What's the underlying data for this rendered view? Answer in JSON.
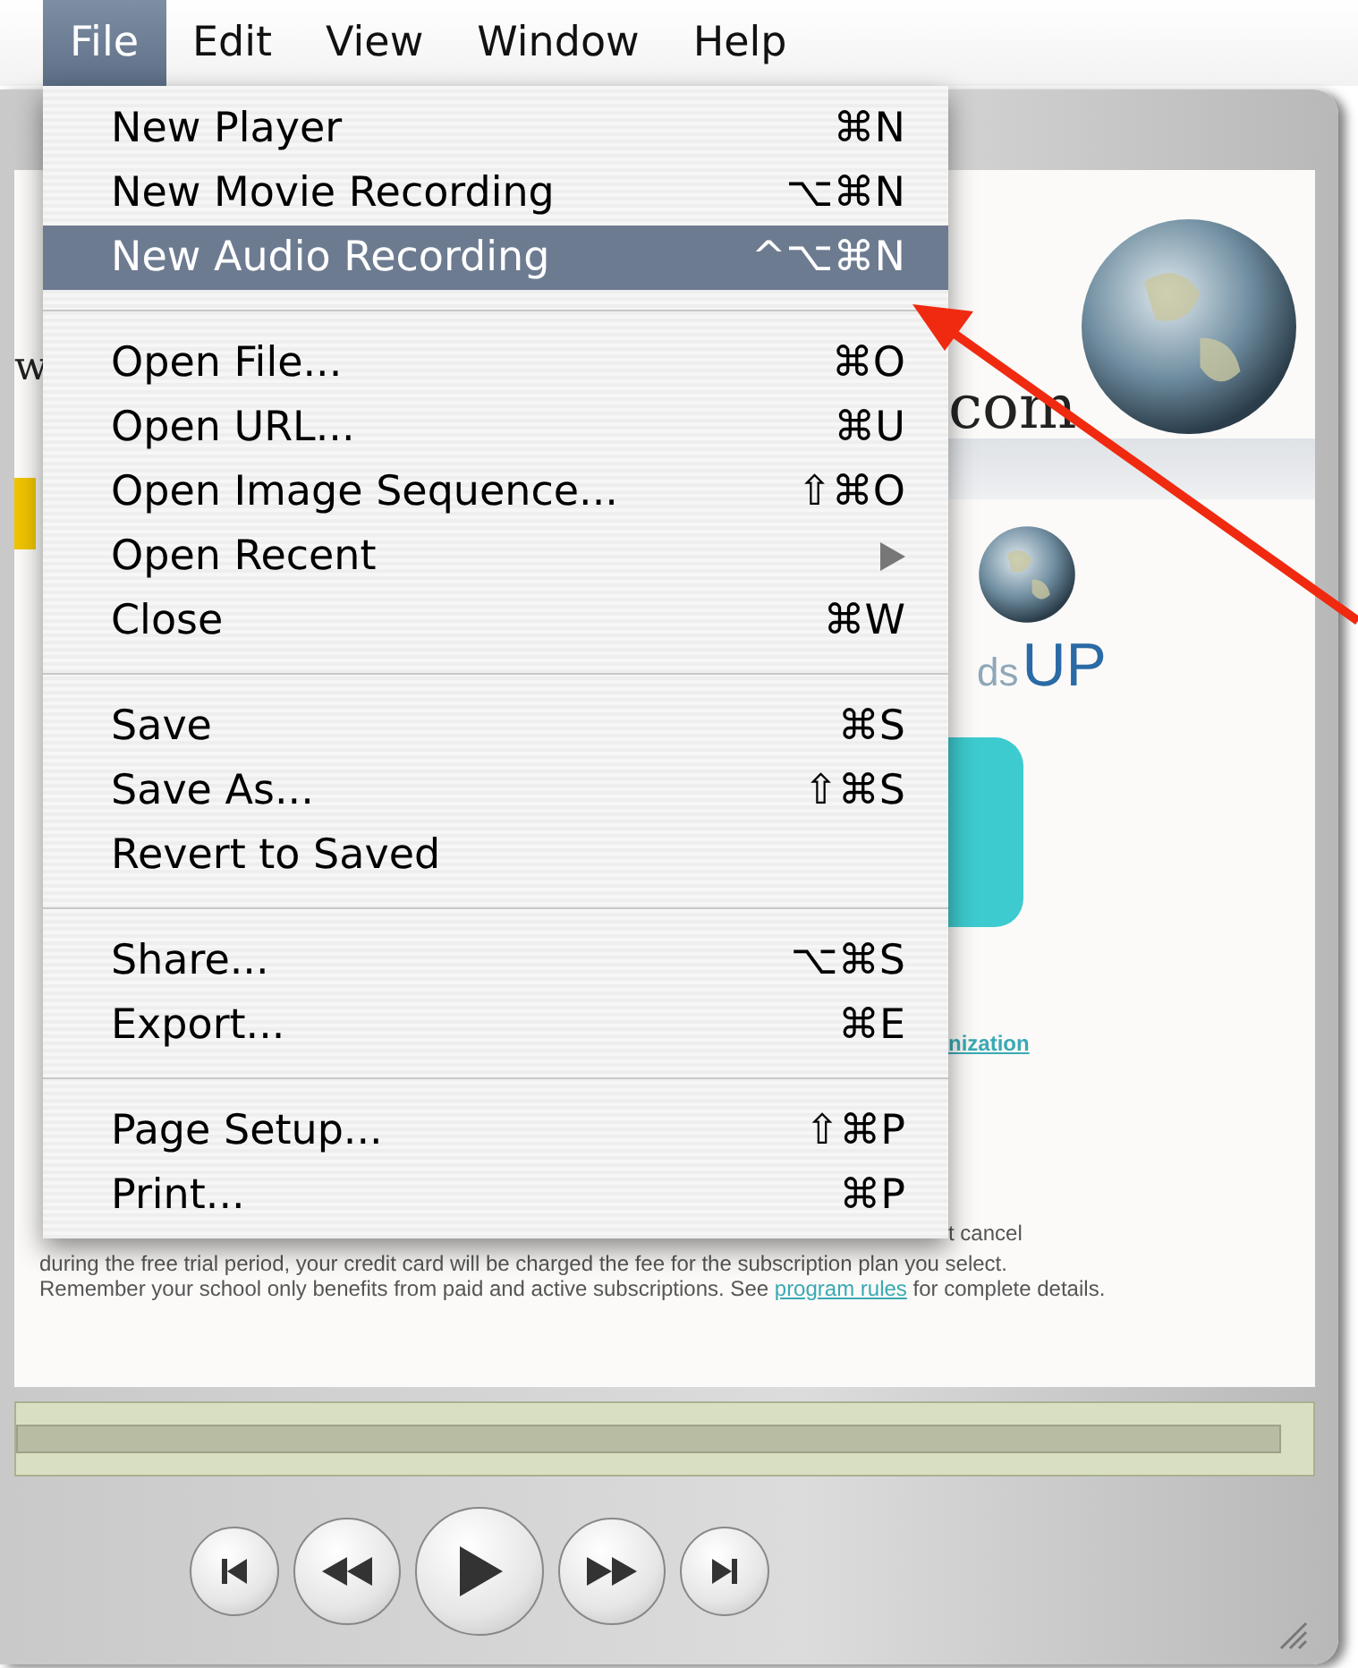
{
  "menu_bar": [
    {
      "label": "File",
      "selected": true
    },
    {
      "label": "Edit",
      "selected": false
    },
    {
      "label": "View",
      "selected": false
    },
    {
      "label": "Window",
      "selected": false
    },
    {
      "label": "Help",
      "selected": false
    }
  ],
  "menu": {
    "groups": [
      [
        {
          "kind": "item",
          "label": "New Player",
          "shortcut": "⌘N",
          "highlighted": false
        },
        {
          "kind": "item",
          "label": "New Movie Recording",
          "shortcut": "⌥⌘N",
          "highlighted": false
        },
        {
          "kind": "item",
          "label": "New Audio Recording",
          "shortcut": "^⌥⌘N",
          "highlighted": true
        }
      ],
      [
        {
          "kind": "item",
          "label": "Open File...",
          "shortcut": "⌘O",
          "highlighted": false
        },
        {
          "kind": "item",
          "label": "Open URL...",
          "shortcut": "⌘U",
          "highlighted": false
        },
        {
          "kind": "item",
          "label": "Open Image Sequence...",
          "shortcut": "⇧⌘O",
          "highlighted": false
        },
        {
          "kind": "submenu",
          "label": "Open Recent",
          "highlighted": false
        },
        {
          "kind": "item",
          "label": "Close",
          "shortcut": "⌘W",
          "highlighted": false
        }
      ],
      [
        {
          "kind": "item",
          "label": "Save",
          "shortcut": "⌘S",
          "highlighted": false
        },
        {
          "kind": "item",
          "label": "Save As...",
          "shortcut": "⇧⌘S",
          "highlighted": false
        },
        {
          "kind": "item",
          "label": "Revert to Saved",
          "highlighted": false
        }
      ],
      [
        {
          "kind": "item",
          "label": "Share...",
          "shortcut": "⌥⌘S",
          "highlighted": false
        },
        {
          "kind": "item",
          "label": "Export...",
          "shortcut": "⌘E",
          "highlighted": false
        }
      ],
      [
        {
          "kind": "item",
          "label": "Page Setup...",
          "shortcut": "⇧⌘P",
          "highlighted": false
        },
        {
          "kind": "item",
          "label": "Print...",
          "shortcut": "⌘P",
          "highlighted": false
        }
      ]
    ]
  },
  "page": {
    "url_start": "w",
    "url_end": "com",
    "logo": {
      "part": "ds",
      "up": "UP"
    },
    "link_fragment": "nization",
    "line_fragment": "t cancel",
    "notice": {
      "text": "during the free trial period, your credit card will be charged the fee for the subscription plan you select. Remember your school only benefits from paid and active subscriptions. See",
      "link": "program rules",
      "after": "for complete details."
    }
  },
  "controls": [
    {
      "kind": "start"
    },
    {
      "kind": "rewind"
    },
    {
      "kind": "play"
    },
    {
      "kind": "forward"
    },
    {
      "kind": "end"
    }
  ]
}
